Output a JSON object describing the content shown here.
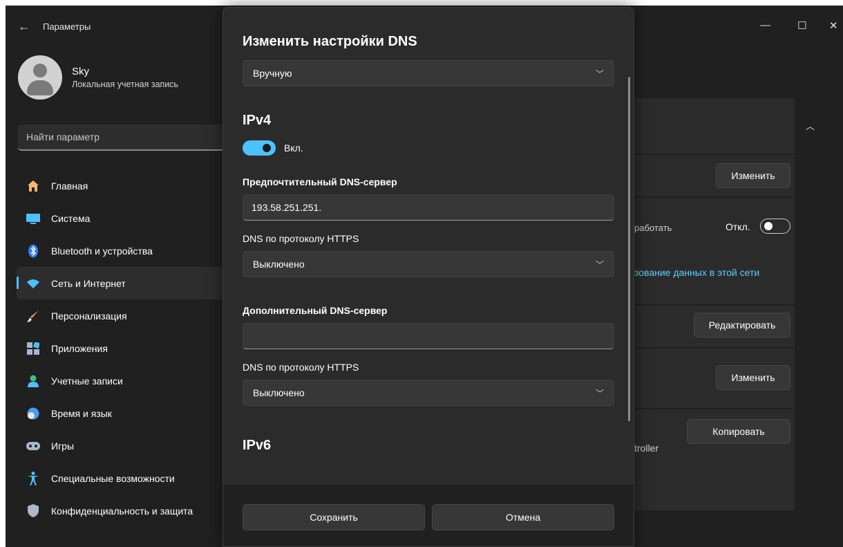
{
  "sidebar": {
    "back_icon": "←",
    "app_title": "Параметры",
    "profile": {
      "name": "Sky",
      "account_type": "Локальная учетная запись"
    },
    "search_placeholder": "Найти параметр",
    "items": [
      {
        "label": "Главная",
        "icon": "home-icon",
        "color": "#ffb86b"
      },
      {
        "label": "Система",
        "icon": "system-icon",
        "color": "#4cc2ff"
      },
      {
        "label": "Bluetooth и устройства",
        "icon": "bluetooth-icon",
        "color": "#2f7cf6"
      },
      {
        "label": "Сеть и Интернет",
        "icon": "network-icon",
        "color": "#4cc2ff",
        "active": true
      },
      {
        "label": "Персонализация",
        "icon": "brush-icon",
        "color": "#f2a35e"
      },
      {
        "label": "Приложения",
        "icon": "apps-icon",
        "color": "#a8b8cc"
      },
      {
        "label": "Учетные записи",
        "icon": "accounts-icon",
        "color": "#3fbf7f"
      },
      {
        "label": "Время и язык",
        "icon": "time-language-icon",
        "color": "#4c9be8"
      },
      {
        "label": "Игры",
        "icon": "gaming-icon",
        "color": "#a8b8cc"
      },
      {
        "label": "Специальные возможности",
        "icon": "accessibility-icon",
        "color": "#4cc2ff"
      },
      {
        "label": "Конфиденциальность и защита",
        "icon": "shield-icon",
        "color": "#b0b8c4"
      }
    ]
  },
  "background": {
    "window_controls": {
      "minimize": "—",
      "maximize": "☐",
      "close": "✕"
    },
    "chevron_up": "︿",
    "buttons": {
      "change_1": "Изменить",
      "edit": "Редактировать",
      "change_2": "Изменить",
      "copy": "Копировать"
    },
    "metered_text": "работать",
    "toggle_off_label": "Откл.",
    "link_text": "зование данных в этой сети",
    "controller_text": "troller"
  },
  "dialog": {
    "title": "Изменить настройки DNS",
    "mode_select": "Вручную",
    "ipv4": {
      "heading": "IPv4",
      "toggle_label": "Вкл.",
      "preferred_label": "Предпочтительный DNS-сервер",
      "preferred_value": "193.58.251.251.",
      "https_label_1": "DNS по протоколу HTTPS",
      "https_value_1": "Выключено",
      "alternate_label": "Дополнительный DNS-сервер",
      "alternate_value": "",
      "https_label_2": "DNS по протоколу HTTPS",
      "https_value_2": "Выключено"
    },
    "ipv6": {
      "heading": "IPv6"
    },
    "save_button": "Сохранить",
    "cancel_button": "Отмена"
  }
}
